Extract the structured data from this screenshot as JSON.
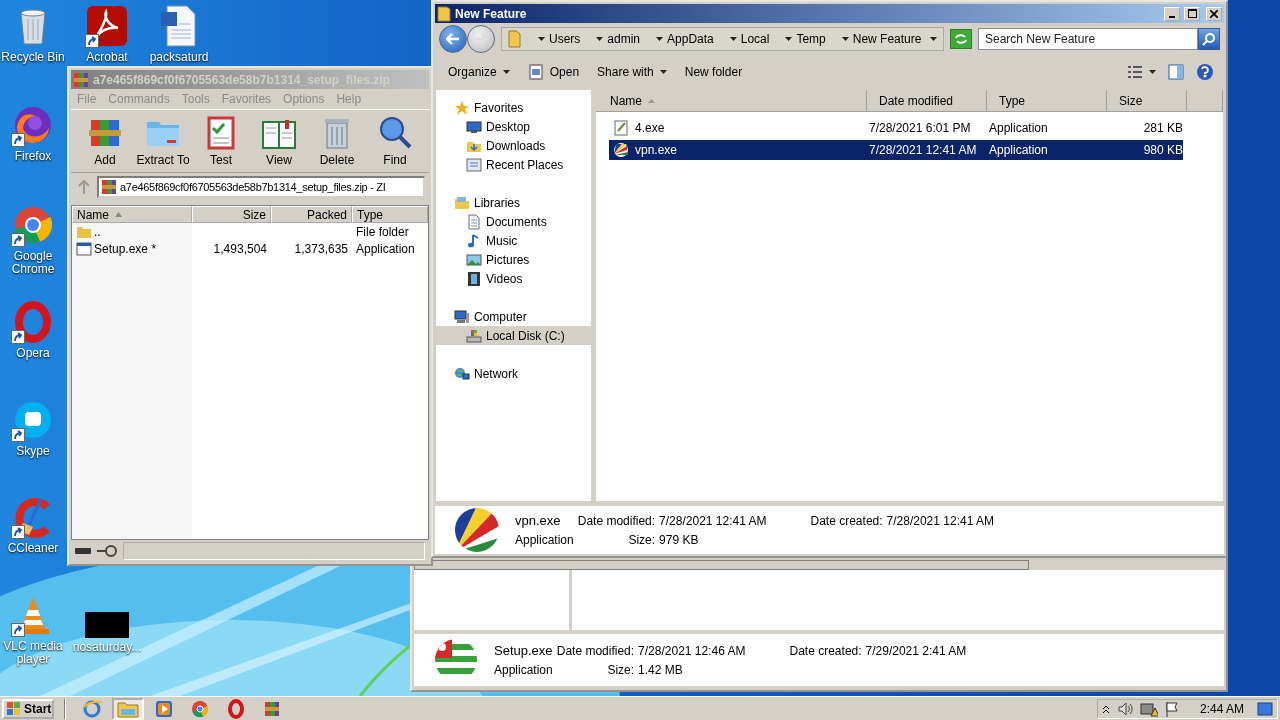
{
  "desktop_icons": [
    {
      "label": "Recycle Bin",
      "shortcut": false
    },
    {
      "label": "Acrobat",
      "shortcut": true
    },
    {
      "label": "packsaturd",
      "shortcut": false
    },
    {
      "label": "Firefox",
      "shortcut": true
    },
    {
      "label": "Google Chrome",
      "shortcut": true
    },
    {
      "label": "Opera",
      "shortcut": true
    },
    {
      "label": "Skype",
      "shortcut": true
    },
    {
      "label": "CCleaner",
      "shortcut": true
    },
    {
      "label": "VLC media player",
      "shortcut": true
    },
    {
      "label": "nosaturday...",
      "shortcut": false
    }
  ],
  "archive_window": {
    "title": "a7e465f869cf0f6705563de58b7b1314_setup_files.zip",
    "active": false,
    "menu": [
      "File",
      "Commands",
      "Tools",
      "Favorites",
      "Options",
      "Help"
    ],
    "toolbar": [
      "Add",
      "Extract To",
      "Test",
      "View",
      "Delete",
      "Find"
    ],
    "path": "a7e465f869cf0f6705563de58b7b1314_setup_files.zip - ZI",
    "columns": [
      {
        "label": "Name",
        "sorted": true
      },
      {
        "label": "Size",
        "sorted": false
      },
      {
        "label": "Packed",
        "sorted": false
      },
      {
        "label": "Type",
        "sorted": false
      }
    ],
    "rows": [
      {
        "kind": "folder",
        "name": "..",
        "type": "File folder"
      },
      {
        "kind": "file",
        "name": "Setup.exe *",
        "size": "1,493,504",
        "packed": "1,373,635",
        "type": "Application"
      }
    ]
  },
  "explorer_window": {
    "title": "New Feature",
    "active": true,
    "breadcrumb": [
      "Users",
      "admin",
      "AppData",
      "Local",
      "Temp",
      "New Feature"
    ],
    "search": {
      "placeholder": "Search New Feature"
    },
    "toolbar": [
      {
        "kind": "menu",
        "label": "Organize"
      },
      {
        "kind": "open",
        "label": "Open"
      },
      {
        "kind": "menu",
        "label": "Share with"
      },
      {
        "kind": "plain",
        "label": "New folder"
      }
    ],
    "nav": [
      {
        "label": "Favorites",
        "selected": false,
        "children": [
          {
            "label": "Desktop",
            "selected": false
          },
          {
            "label": "Downloads",
            "selected": false
          },
          {
            "label": "Recent Places",
            "selected": false
          }
        ]
      },
      {
        "label": "Libraries",
        "selected": false,
        "children": [
          {
            "label": "Documents",
            "selected": false
          },
          {
            "label": "Music",
            "selected": false
          },
          {
            "label": "Pictures",
            "selected": false
          },
          {
            "label": "Videos",
            "selected": false
          }
        ]
      },
      {
        "label": "Computer",
        "selected": false,
        "children": [
          {
            "label": "Local Disk (C:)",
            "selected": true
          }
        ]
      },
      {
        "label": "Network",
        "selected": false
      }
    ],
    "columns": [
      {
        "label": "Name",
        "sorted": true
      },
      {
        "label": "Date modified",
        "sorted": false
      },
      {
        "label": "Type",
        "sorted": false
      },
      {
        "label": "Size",
        "sorted": false
      }
    ],
    "files": [
      {
        "name": "4.exe",
        "modified": "7/28/2021 6:01 PM",
        "type": "Application",
        "size": "281 KB",
        "selected": false
      },
      {
        "name": "vpn.exe",
        "modified": "7/28/2021 12:41 AM",
        "type": "Application",
        "size": "980 KB",
        "selected": true
      }
    ],
    "details": {
      "name": "vpn.exe",
      "type": "Application",
      "fields": [
        {
          "label": "Date modified:",
          "value": "7/28/2021 12:41 AM"
        },
        {
          "label": "Date created:",
          "value": "7/28/2021 12:41 AM"
        },
        {
          "label": "Size:",
          "value": "979 KB"
        }
      ]
    }
  },
  "back_window": {
    "details": {
      "name": "Setup.exe",
      "type": "Application",
      "fields": [
        {
          "label": "Date modified:",
          "value": "7/28/2021 12:46 AM"
        },
        {
          "label": "Date created:",
          "value": "7/29/2021 2:41 AM"
        },
        {
          "label": "Size:",
          "value": "1.42 MB"
        }
      ]
    }
  },
  "taskbar": {
    "start": "Start",
    "items": [
      {
        "selected": false
      },
      {
        "selected": true
      },
      {
        "selected": false
      },
      {
        "selected": false
      },
      {
        "selected": false
      },
      {
        "selected": false
      }
    ],
    "clock": "2:44 AM"
  }
}
